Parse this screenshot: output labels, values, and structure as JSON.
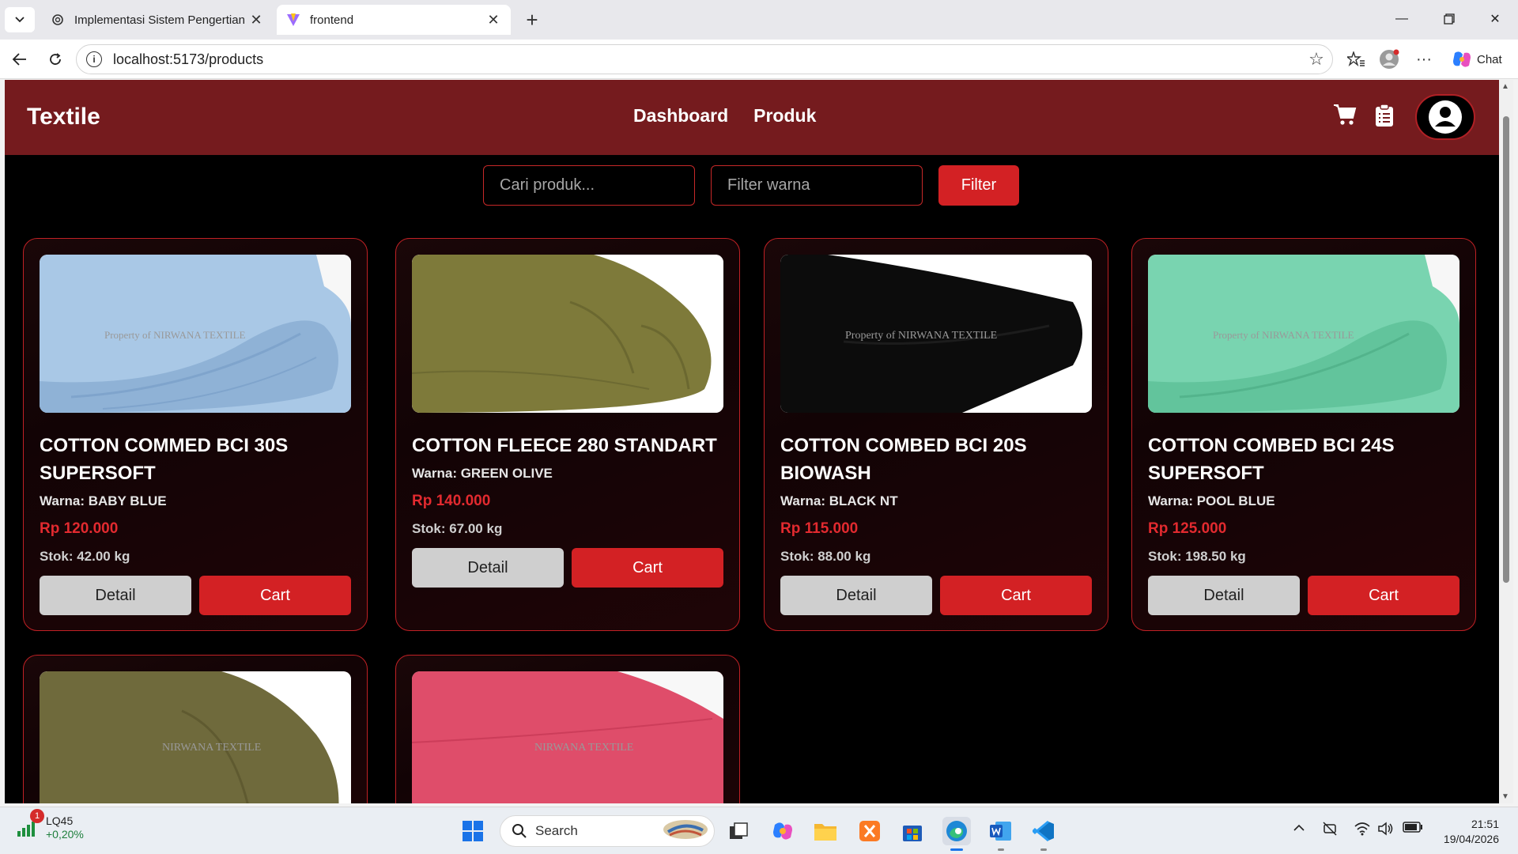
{
  "browser": {
    "tabs": [
      {
        "title": "Implementasi Sistem Pengertian",
        "active": false
      },
      {
        "title": "frontend",
        "active": true
      }
    ],
    "url": "localhost:5173/products",
    "chat_label": "Chat"
  },
  "app": {
    "brand": "Textile",
    "nav": [
      "Dashboard",
      "Produk"
    ],
    "search_placeholder": "Cari produk...",
    "color_placeholder": "Filter warna",
    "filter_label": "Filter",
    "products": [
      {
        "name": "COTTON COMMED BCI 30S SUPERSOFT",
        "color_label": "Warna: BABY BLUE",
        "price": "Rp 120.000",
        "stock": "Stok: 42.00 kg",
        "detail": "Detail",
        "cart": "Cart",
        "fabric": "#a9c8e6",
        "watermark": "Property of NIRWANA TEXTILE"
      },
      {
        "name": "COTTON FLEECE 280 STANDART",
        "color_label": "Warna: GREEN OLIVE",
        "price": "Rp 140.000",
        "stock": "Stok: 67.00 kg",
        "detail": "Detail",
        "cart": "Cart",
        "fabric": "#7e7a3a",
        "watermark": ""
      },
      {
        "name": "COTTON COMBED BCI 20S BIOWASH",
        "color_label": "Warna: BLACK NT",
        "price": "Rp 115.000",
        "stock": "Stok: 88.00 kg",
        "detail": "Detail",
        "cart": "Cart",
        "fabric": "#0c0c0c",
        "watermark": "Property of NIRWANA TEXTILE"
      },
      {
        "name": "COTTON COMBED BCI 24S SUPERSOFT",
        "color_label": "Warna: POOL BLUE",
        "price": "Rp 125.000",
        "stock": "Stok: 198.50 kg",
        "detail": "Detail",
        "cart": "Cart",
        "fabric": "#79d4b0",
        "watermark": "Property of NIRWANA TEXTILE"
      },
      {
        "fabric": "#6f6a3c",
        "watermark": "NIRWANA TEXTILE"
      },
      {
        "fabric": "#df4d6a",
        "watermark": "NIRWANA TEXTILE"
      }
    ]
  },
  "taskbar": {
    "stock_ticker": "LQ45",
    "stock_change": "+0,20%",
    "notification_count": "1",
    "search_label": "Search",
    "time": "21:51",
    "date": "19/04/2026"
  },
  "colors": {
    "nav_bg": "#751b1e",
    "accent": "#d32124",
    "card_border": "#c02125",
    "price": "#e22a2f"
  }
}
